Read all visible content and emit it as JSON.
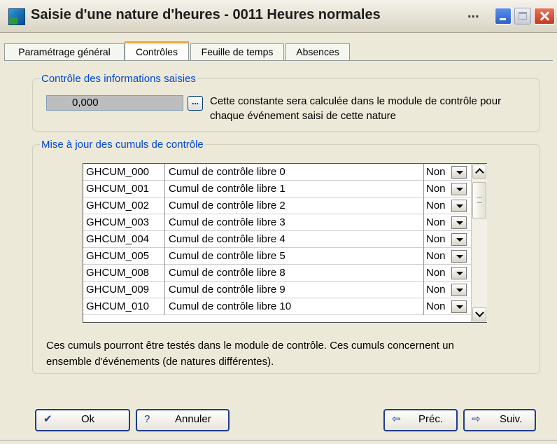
{
  "window": {
    "title": "Saisie d'une nature d'heures - 0011 Heures normales",
    "title_ellipsis": "..."
  },
  "tabs": [
    {
      "label": "Paramétrage général",
      "active": false
    },
    {
      "label": "Contrôles",
      "active": true
    },
    {
      "label": "Feuille de temps",
      "active": false
    },
    {
      "label": "Absences",
      "active": false
    }
  ],
  "controle": {
    "legend": "Contrôle des informations saisies",
    "value": "0,000",
    "ellipsis_label": "...",
    "hint": "Cette constante sera calculée dans le module de contrôle pour chaque événement saisi de cette nature"
  },
  "cumuls": {
    "legend": "Mise à jour des cumuls de contrôle",
    "rows": [
      {
        "code": "GHCUM_000",
        "label": "Cumul de contrôle libre 0",
        "value": "Non"
      },
      {
        "code": "GHCUM_001",
        "label": "Cumul de contrôle libre 1",
        "value": "Non"
      },
      {
        "code": "GHCUM_002",
        "label": "Cumul de contrôle libre 2",
        "value": "Non"
      },
      {
        "code": "GHCUM_003",
        "label": "Cumul de contrôle libre 3",
        "value": "Non"
      },
      {
        "code": "GHCUM_004",
        "label": "Cumul de contrôle libre 4",
        "value": "Non"
      },
      {
        "code": "GHCUM_005",
        "label": "Cumul de contrôle libre 5",
        "value": "Non"
      },
      {
        "code": "GHCUM_008",
        "label": "Cumul de contrôle libre 8",
        "value": "Non"
      },
      {
        "code": "GHCUM_009",
        "label": "Cumul de contrôle libre 9",
        "value": "Non"
      },
      {
        "code": "GHCUM_010",
        "label": "Cumul de contrôle libre 10",
        "value": "Non"
      }
    ],
    "note": "Ces cumuls pourront être testés dans le module de contrôle. Ces cumuls concernent un ensemble d'événements (de natures différentes)."
  },
  "buttons": {
    "ok": "Ok",
    "annuler": "Annuler",
    "prec": "Préc.",
    "suiv": "Suiv."
  }
}
